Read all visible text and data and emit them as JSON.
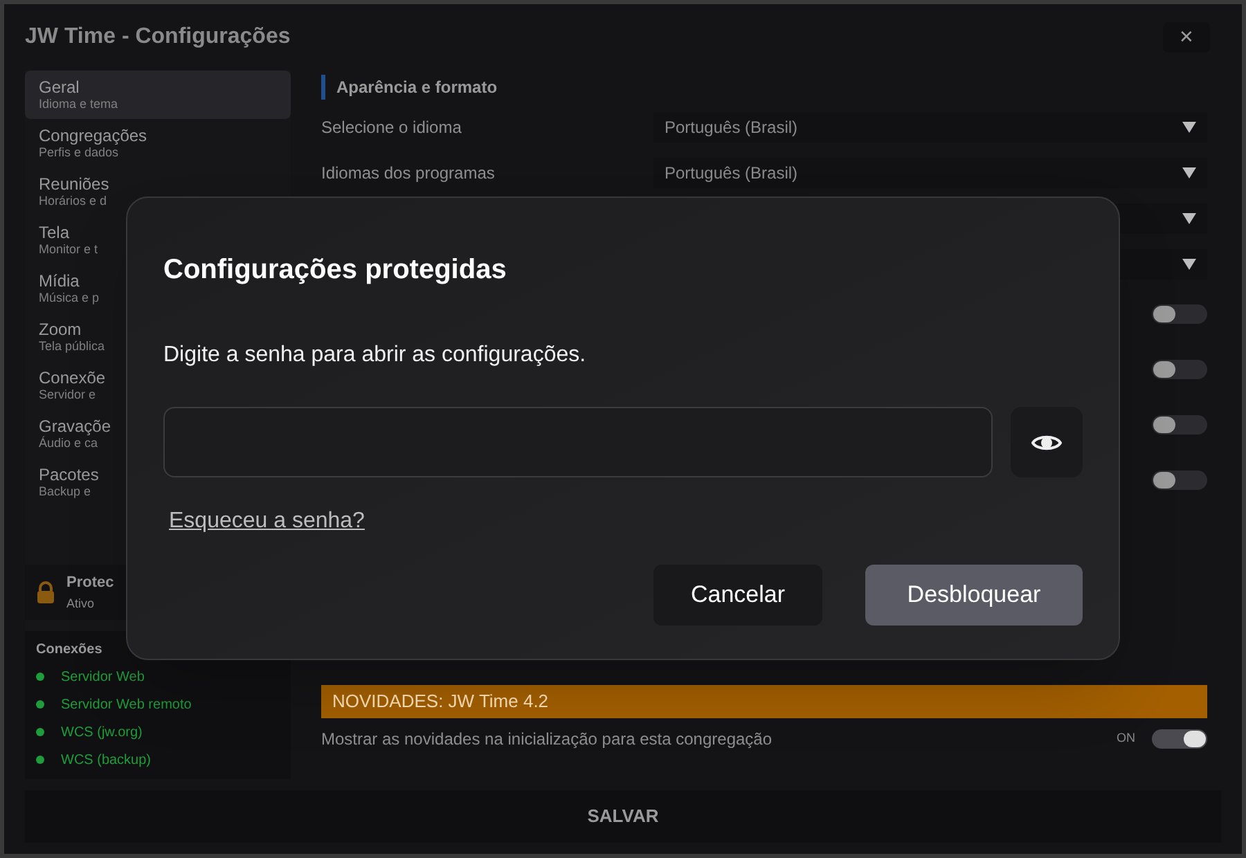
{
  "window": {
    "title": "JW Time - Configurações",
    "close": "✕"
  },
  "sidebar": {
    "items": [
      {
        "label": "Geral",
        "subtitle": "Idioma e tema",
        "selected": true
      },
      {
        "label": "Congregações",
        "subtitle": "Perfis e dados",
        "selected": false
      },
      {
        "label": "Reuniões",
        "subtitle": "Horários e d",
        "selected": false
      },
      {
        "label": "Tela",
        "subtitle": "Monitor e t",
        "selected": false
      },
      {
        "label": "Mídia",
        "subtitle": "Música e p",
        "selected": false
      },
      {
        "label": "Zoom",
        "subtitle": "Tela pública",
        "selected": false
      },
      {
        "label": "Conexõe",
        "subtitle": "Servidor e",
        "selected": false
      },
      {
        "label": "Gravaçõe",
        "subtitle": "Áudio e ca",
        "selected": false
      },
      {
        "label": "Pacotes",
        "subtitle": "Backup e",
        "selected": false
      }
    ],
    "protection": {
      "title": "Protec",
      "status": "Ativo"
    },
    "connections": {
      "title": "Conexões",
      "items": [
        {
          "label": "Servidor Web",
          "color": "#1f9d3a"
        },
        {
          "label": "Servidor Web remoto",
          "color": "#1f9d3a"
        },
        {
          "label": "WCS (jw.org)",
          "color": "#1f9d3a"
        },
        {
          "label": "WCS (backup)",
          "color": "#1f9d3a"
        }
      ]
    }
  },
  "panel": {
    "section": "Aparência e formato",
    "rows": [
      {
        "kind": "select",
        "label": "Selecione o idioma",
        "value": "Português (Brasil)"
      },
      {
        "kind": "select",
        "label": "Idiomas dos programas",
        "value": "Português (Brasil)"
      },
      {
        "kind": "select"
      },
      {
        "kind": "select"
      },
      {
        "kind": "toggle",
        "on": false
      },
      {
        "kind": "toggle",
        "on": false
      },
      {
        "kind": "toggle",
        "on": false
      },
      {
        "kind": "toggle",
        "on": false
      }
    ],
    "news": {
      "title": "NOVIDADES: JW Time 4.2",
      "label": "Mostrar as novidades na inicialização para esta congregação",
      "state": "ON",
      "on": true
    }
  },
  "save": "SALVAR",
  "dialog": {
    "title": "Configurações protegidas",
    "message": "Digite a senha para abrir as configurações.",
    "forgot": "Esqueceu a senha?",
    "buttons": [
      {
        "kind": "secondary",
        "label": "Cancelar"
      },
      {
        "kind": "primary",
        "label": "Desbloquear"
      }
    ]
  }
}
